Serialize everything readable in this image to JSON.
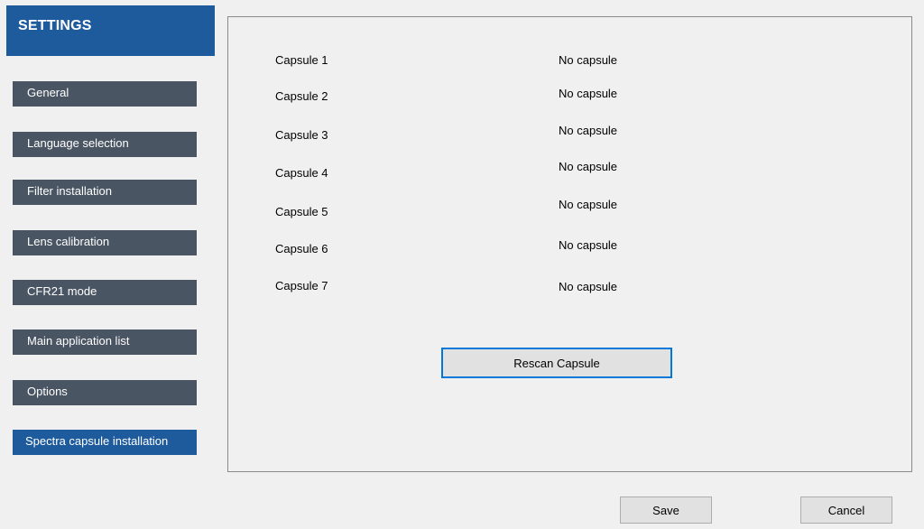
{
  "header": {
    "title": "SETTINGS"
  },
  "sidebar": {
    "items": [
      {
        "label": "General"
      },
      {
        "label": "Language selection"
      },
      {
        "label": "Filter installation"
      },
      {
        "label": "Lens calibration"
      },
      {
        "label": "CFR21 mode"
      },
      {
        "label": "Main application list"
      },
      {
        "label": "Options"
      },
      {
        "label": "Spectra capsule installation"
      }
    ]
  },
  "capsules": [
    {
      "label": "Capsule 1",
      "status": "No capsule"
    },
    {
      "label": "Capsule 2",
      "status": "No capsule"
    },
    {
      "label": "Capsule 3",
      "status": "No capsule"
    },
    {
      "label": "Capsule 4",
      "status": "No capsule"
    },
    {
      "label": "Capsule 5",
      "status": "No capsule"
    },
    {
      "label": "Capsule 6",
      "status": "No capsule"
    },
    {
      "label": "Capsule 7",
      "status": "No capsule"
    }
  ],
  "panel": {
    "rescan_label": "Rescan Capsule"
  },
  "footer": {
    "save_label": "Save",
    "cancel_label": "Cancel"
  },
  "colors": {
    "header_bg": "#1e5b9d",
    "nav_bg": "#4a5563",
    "nav_active_bg": "#1e5b9d",
    "focus_border": "#0078d7"
  }
}
